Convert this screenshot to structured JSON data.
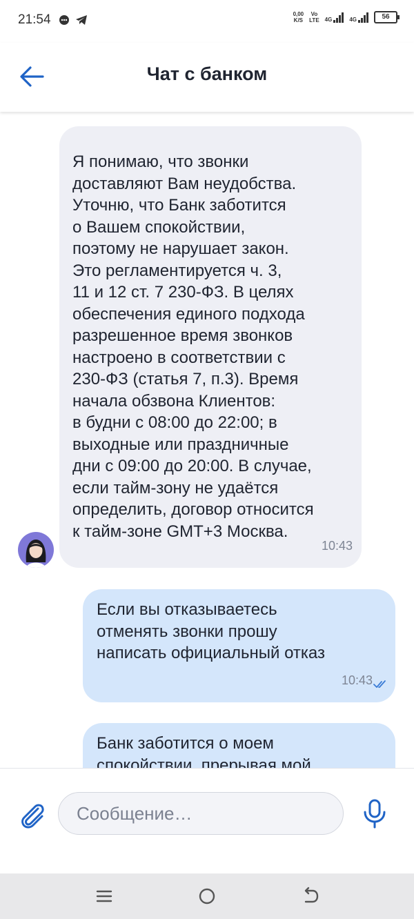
{
  "status_bar": {
    "time": "21:54",
    "speed_value": "0,00",
    "speed_unit": "K/S",
    "volte_top": "Vo",
    "volte_bottom": "LTE",
    "network1": "4G",
    "network2": "4G",
    "battery": "56"
  },
  "header": {
    "title": "Чат с банком"
  },
  "messages": [
    {
      "direction": "incoming",
      "text": "Я понимаю, что звонки\nдоставляют Вам неудобства.\nУточню, что Банк заботится\nо Вашем спокойствии,\nпоэтому не нарушает закон.\nЭто регламентируется ч. 3,\n11 и 12 ст. 7 230-ФЗ. В целях\nобеспечения единого подхода\nразрешенное время звонков\nнастроено в соответствии с\n230-ФЗ (статья 7, п.3). Время\nначала обзвона Клиентов:\nв будни с 08:00 до 22:00; в\nвыходные или праздничные\nдни с 09:00 до 20:00. В случае,\nесли тайм-зону не удаётся\nопределить, договор относится\nк тайм-зоне GMT+3 Москва.",
      "time": "10:43"
    },
    {
      "direction": "outgoing",
      "text": "Если вы отказываетесь\nотменять звонки прошу\nнаписать официальный отказ",
      "time": "10:43",
      "status": "read"
    },
    {
      "direction": "outgoing",
      "text": "Банк заботится о моем\nспокойствии, прерывая мой"
    }
  ],
  "input": {
    "placeholder": "Сообщение…"
  },
  "icons": {
    "back": "arrow-left-icon",
    "attach": "paperclip-icon",
    "mic": "microphone-icon",
    "avatar": "operator-avatar",
    "nav_recent": "menu-icon",
    "nav_home": "circle-icon",
    "nav_back": "return-icon"
  },
  "colors": {
    "accent": "#1f63c6",
    "incoming_bubble": "#eeeff5",
    "outgoing_bubble": "#d4e6fb",
    "avatar_bg": "#7f78d8"
  }
}
